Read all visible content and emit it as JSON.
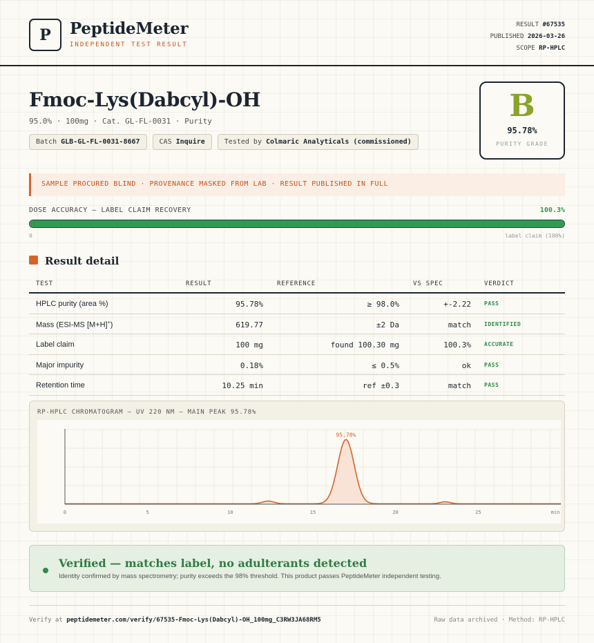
{
  "header": {
    "logo_letter": "P",
    "brand": "PeptideMeter",
    "tagline": "INDEPENDENT TEST RESULT",
    "meta": [
      {
        "label": "RESULT",
        "value": "#67535"
      },
      {
        "label": "PUBLISHED",
        "value": "2026-03-26"
      },
      {
        "label": "SCOPE",
        "value": "RP-HPLC"
      }
    ]
  },
  "product": {
    "name": "Fmoc-Lys(Dabcyl)-OH",
    "subtitle": "95.0% · 100mg · Cat. GL-FL-0031 · Purity",
    "chips": [
      {
        "label": "Batch",
        "value": "GLB-GL-FL-0031-8667"
      },
      {
        "label": "CAS",
        "value": "Inquire"
      },
      {
        "label": "Tested by",
        "value": "Colmaric Analyticals (commissioned)"
      }
    ]
  },
  "grade": {
    "letter": "B",
    "value": "95.78%",
    "label": "PURITY GRADE",
    "color": "#8aa42a"
  },
  "banner": "SAMPLE PROCURED BLIND · PROVENANCE MASKED FROM LAB · RESULT PUBLISHED IN FULL",
  "dose": {
    "label": "DOSE ACCURACY — LABEL CLAIM RECOVERY",
    "value_text": "100.3%",
    "percent": 100.3,
    "min_label": "0",
    "max_label": "label claim (100%)"
  },
  "section_title": "Result detail",
  "table": {
    "headers": {
      "test": "TEST",
      "result": "RESULT",
      "reference": "REFERENCE",
      "vs_spec": "VS SPEC",
      "verdict": "VERDICT"
    },
    "rows": [
      {
        "test": "HPLC purity (area %)",
        "result": "95.78%",
        "reference": "≥ 98.0%",
        "vs_spec": "+-2.22",
        "verdict": "PASS"
      },
      {
        "test": "Mass (ESI-MS [M+H]",
        "test_sup": "+",
        "test_end": ")",
        "result": "619.77",
        "reference": "±2 Da",
        "vs_spec": "match",
        "verdict": "IDENTIFIED"
      },
      {
        "test": "Label claim",
        "result": "100 mg",
        "reference": "found 100.30 mg",
        "vs_spec": "100.3%",
        "verdict": "ACCURATE"
      },
      {
        "test": "Major impurity",
        "result": "0.18%",
        "reference": "≤ 0.5%",
        "vs_spec": "ok",
        "verdict": "PASS"
      },
      {
        "test": "Retention time",
        "result": "10.25 min",
        "reference": "ref ±0.3",
        "vs_spec": "match",
        "verdict": "PASS"
      }
    ]
  },
  "chart_data": {
    "type": "line",
    "title": "RP-HPLC CHROMATOGRAM — UV 220 NM — MAIN PEAK 95.78%",
    "x_ticks": [
      0,
      5,
      10,
      15,
      20,
      25
    ],
    "x_unit_label": "min",
    "xlim": [
      0,
      30
    ],
    "ylim": [
      0,
      100
    ],
    "baseline": 0.6,
    "peaks": [
      {
        "center": 12.3,
        "height": 4,
        "width": 0.35
      },
      {
        "center": 17.0,
        "height": 95.78,
        "width": 0.5,
        "label": "95.78%"
      },
      {
        "center": 23.0,
        "height": 3,
        "width": 0.3
      }
    ],
    "line_color": "#d8632a",
    "fill_color": "#f8e3d6",
    "grid": true
  },
  "verified": {
    "title": "Verified — matches label, no adulterants detected",
    "body": "Identity confirmed by mass spectrometry; purity exceeds the 98% threshold. This product passes PeptideMeter independent testing."
  },
  "footer": {
    "verify_prefix": "Verify at",
    "verify_url": "peptidemeter.com/verify/67535-Fmoc-Lys(Dabcyl)-OH_100mg_C3RW3JA68RM5",
    "right": "Raw data archived · Method: RP-HPLC"
  }
}
